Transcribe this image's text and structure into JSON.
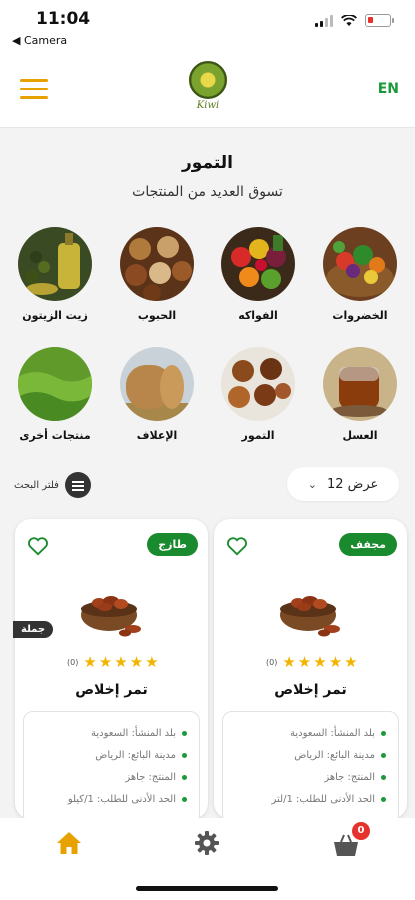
{
  "status_bar": {
    "time": "11:04",
    "back_label": "◀ Camera"
  },
  "header": {
    "logo_text": "Kiwi",
    "language_button": "EN"
  },
  "page": {
    "title": "التمور",
    "subtitle": "تسوق العديد من المنتجات"
  },
  "categories": [
    {
      "label": "الخضروات",
      "icon": "vegetables-photo"
    },
    {
      "label": "الفواكه",
      "icon": "fruits-photo"
    },
    {
      "label": "الحبوب",
      "icon": "grains-photo"
    },
    {
      "label": "زيت الزيتون",
      "icon": "olive-oil-photo"
    },
    {
      "label": "العسل",
      "icon": "honey-photo"
    },
    {
      "label": "التمور",
      "icon": "dates-photo"
    },
    {
      "label": "الإعلاف",
      "icon": "fodder-photo"
    },
    {
      "label": "منتجات أخرى",
      "icon": "other-products-photo"
    }
  ],
  "filter": {
    "search_filter_label": "فلتر البحث",
    "display_label": "عرض 12"
  },
  "products": [
    {
      "badge": "مجفف",
      "rating_count": "(0)",
      "stars": 5,
      "name": "تمر إخلاص",
      "details": [
        "بلد المنشأ: السعودية",
        "مدينة البائع: الرياض",
        "المنتج: جاهز",
        "الحد الأدنى للطلب: 1/لتر"
      ]
    },
    {
      "badge": "طازج",
      "wholesale_label": "جملة",
      "rating_count": "(0)",
      "stars": 5,
      "name": "تمر إخلاص",
      "details": [
        "بلد المنشأ: السعودية",
        "مدينة البائع: الرياض",
        "المنتج: جاهز",
        "الحد الأدنى للطلب: 1/كيلو"
      ]
    }
  ],
  "bottom_nav": {
    "cart_count": "0",
    "items": [
      "home-icon",
      "settings-icon",
      "cart-icon"
    ]
  },
  "colors": {
    "accent_yellow": "#e8a200",
    "brand_green": "#1a8a2e",
    "badge_red": "#e5322d",
    "star": "#f2b400"
  }
}
